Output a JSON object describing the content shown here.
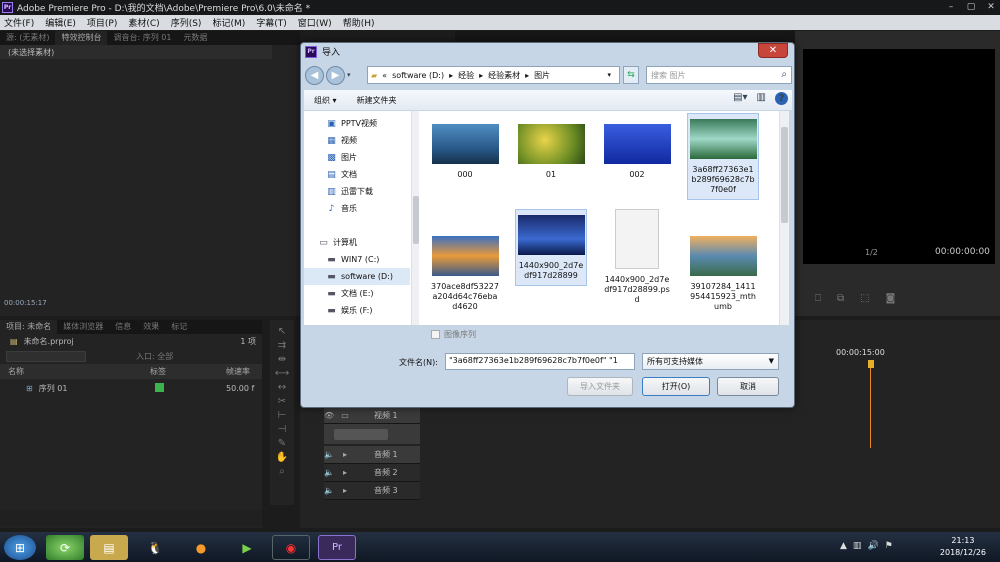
{
  "app": {
    "title": "Adobe Premiere Pro - D:\\我的文档\\Adobe\\Premiere Pro\\6.0\\未命名 *",
    "logo": "Pr"
  },
  "menu": [
    "文件(F)",
    "编辑(E)",
    "项目(P)",
    "素材(C)",
    "序列(S)",
    "标记(M)",
    "字幕(T)",
    "窗口(W)",
    "帮助(H)"
  ],
  "source_panel": {
    "tabs": [
      "源: (无素材)",
      "特效控制台",
      "调音台: 序列 01",
      "元数据"
    ],
    "label": "(未选择素材)",
    "timecode": "00:00:15:17"
  },
  "program_panel": {
    "zoom": "1/2",
    "timecode": "00:00:00:00"
  },
  "project_panel": {
    "tabs": [
      "项目: 未命名",
      "媒体浏览器",
      "信息",
      "效果",
      "标记"
    ],
    "project_file": "未命名.prproj",
    "item_count": "1 项",
    "inpoint_label": "入口: 全部",
    "columns": [
      "名称",
      "标签",
      "帧速率"
    ],
    "items": [
      {
        "name": "序列 01",
        "fps": "50.00 f",
        "label_color": "#3cb44b"
      }
    ]
  },
  "timeline": {
    "ruler_time": "00:00:15:00",
    "tracks": [
      {
        "name": "视频 1",
        "kind": "video"
      },
      {
        "name": "音频 1",
        "kind": "audio"
      },
      {
        "name": "音频 2",
        "kind": "audio"
      },
      {
        "name": "音频 3",
        "kind": "audio"
      }
    ]
  },
  "dialog": {
    "title": "导入",
    "icon": "Pr",
    "close": "✕",
    "breadcrumb": [
      "«",
      "software (D:)",
      "▸",
      "经验",
      "▸",
      "经验素材",
      "▸",
      "图片"
    ],
    "search_placeholder": "搜索 图片",
    "toolbar": {
      "organize": "组织 ▾",
      "new_folder": "新建文件夹"
    },
    "nav_items": [
      {
        "label": "PPTV视频",
        "icon": "video-folder-icon",
        "glyph": "▣"
      },
      {
        "label": "视频",
        "icon": "video-library-icon",
        "glyph": "▦"
      },
      {
        "label": "图片",
        "icon": "pictures-library-icon",
        "glyph": "▩"
      },
      {
        "label": "文档",
        "icon": "documents-library-icon",
        "glyph": "▤"
      },
      {
        "label": "迅雷下载",
        "icon": "download-folder-icon",
        "glyph": "▥"
      },
      {
        "label": "音乐",
        "icon": "music-library-icon",
        "glyph": "♪"
      },
      {
        "label": "计算机",
        "icon": "computer-icon",
        "glyph": "▭"
      },
      {
        "label": "WIN7 (C:)",
        "icon": "drive-icon",
        "glyph": "▬"
      },
      {
        "label": "software (D:)",
        "icon": "drive-icon",
        "glyph": "▬"
      },
      {
        "label": "文档 (E:)",
        "icon": "drive-icon",
        "glyph": "▬"
      },
      {
        "label": "娱乐 (F:)",
        "icon": "drive-icon",
        "glyph": "▬"
      }
    ],
    "files": [
      {
        "name": "000",
        "thumb": "woman-field",
        "selected": false
      },
      {
        "name": "01",
        "thumb": "yellow-flowers",
        "selected": false
      },
      {
        "name": "002",
        "thumb": "fish",
        "selected": false
      },
      {
        "name": "3a68ff27363e1b289f69628c7b7f0e0f",
        "thumb": "waterfall",
        "selected": true
      },
      {
        "name": "370ace8df53227a204d64c76ebad4620",
        "thumb": "mountain-lake",
        "selected": false
      },
      {
        "name": "1440x900_2d7edf917d28899",
        "thumb": "blue-night",
        "selected": true
      },
      {
        "name": "1440x900_2d7edf917d28899.psd",
        "thumb": "blank-file",
        "selected": false
      },
      {
        "name": "39107284_1411954415923_mthumb",
        "thumb": "sunset-coast",
        "selected": false
      }
    ],
    "image_sequence": "图像序列",
    "filename_label": "文件名(N):",
    "filename_value": "\"3a68ff27363e1b289f69628c7b7f0e0f\" \"1",
    "filetype": "所有可支持媒体",
    "buttons": {
      "import_folder": "导入文件夹",
      "open": "打开(O)",
      "cancel": "取消"
    }
  },
  "taskbar": {
    "time": "21:13",
    "date": "2018/12/26"
  }
}
